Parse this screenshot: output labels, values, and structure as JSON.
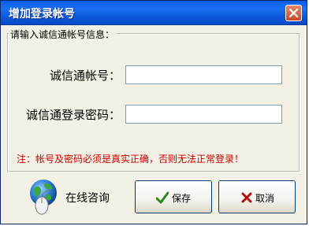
{
  "window": {
    "title": "增加登录帐号"
  },
  "group": {
    "legend": "请输入诚信通帐号信息："
  },
  "fields": {
    "account_label": "诚信通帐号：",
    "account_value": "",
    "password_label": "诚信通登录密码：",
    "password_value": ""
  },
  "note": "注：帐号及密码必须是真实正确，否则无法正常登录！",
  "consult": {
    "label": "在线咨询",
    "icon": "globe-mouse-icon"
  },
  "buttons": {
    "save_label": "保存",
    "save_icon": "checkmark-icon",
    "cancel_label": "取消",
    "cancel_icon": "x-icon"
  },
  "colors": {
    "titlebar": "#0a5ee6",
    "note_text": "#c80000",
    "checkmark": "#2a8a1a",
    "cancel_x": "#b01010"
  }
}
